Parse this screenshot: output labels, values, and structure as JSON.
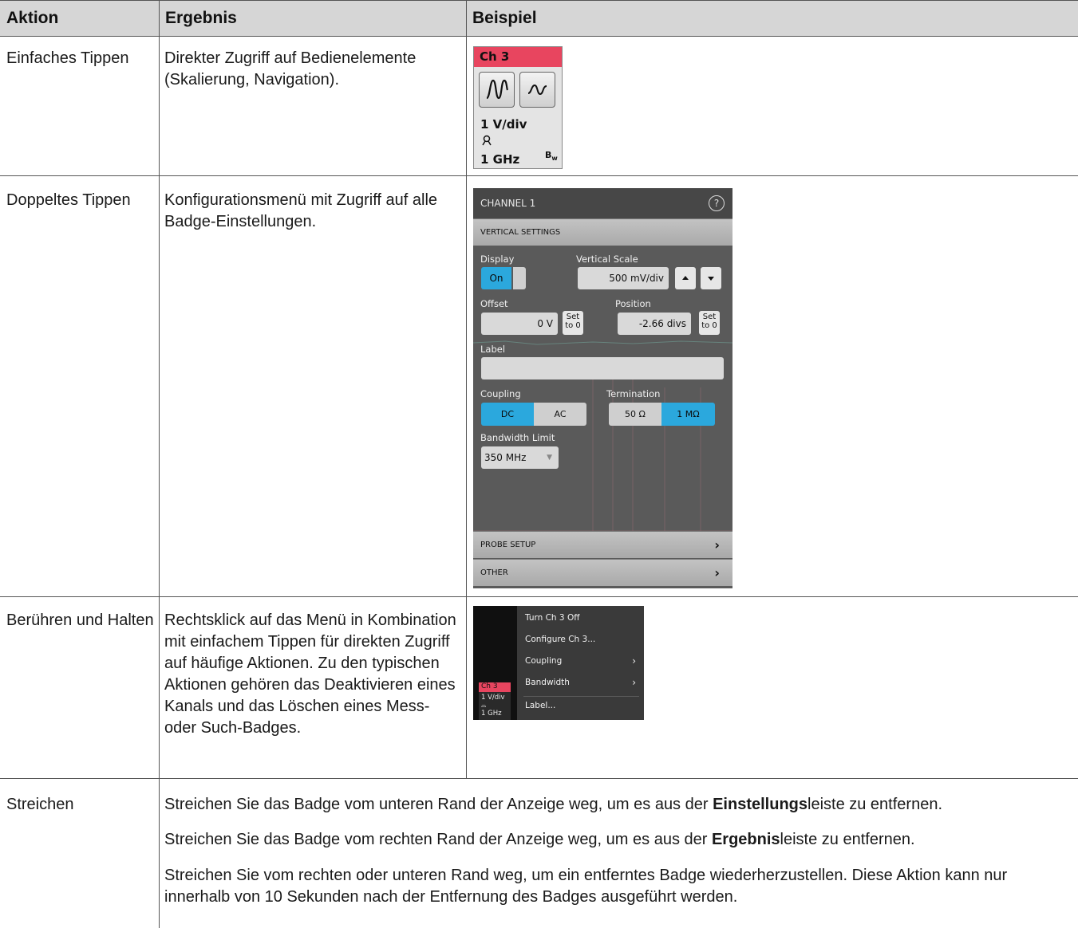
{
  "header": {
    "col_action": "Aktion",
    "col_result": "Ergebnis",
    "col_example": "Beispiel"
  },
  "rows": [
    {
      "action": "Einfaches Tippen",
      "result": "Direkter Zugriff auf Bedienelemente (Skalierung, Navigation)."
    },
    {
      "action": "Doppeltes Tippen",
      "result": "Konfigurationsmenü mit Zugriff auf alle Badge-Einstellungen."
    },
    {
      "action": "Berühren und Halten",
      "result": "Rechtsklick auf das Menü in Kombination mit einfachem Tippen für direkten Zugriff auf häufige Aktionen. Zu den typischen Aktionen gehören das Deaktivieren eines Kanals und das Löschen eines Mess- oder Such-Badges."
    },
    {
      "action": "Streichen",
      "p1_pre": "Streichen Sie das Badge vom unteren Rand der Anzeige weg, um es aus der ",
      "p1_bold": "Einstellungs",
      "p1_post": "leiste zu entfernen.",
      "p2_pre": "Streichen Sie das Badge vom rechten Rand der Anzeige weg, um es aus der ",
      "p2_bold": "Ergebnis",
      "p2_post": "leiste zu entfernen.",
      "p3": "Streichen Sie vom rechten oder unteren Rand weg, um ein entferntes Badge wiederherzustellen. Diese Aktion kann nur innerhalb von 10 Sekunden nach der Entfernung des Badges ausgeführt werden."
    }
  ],
  "example_badge": {
    "title": "Ch 3",
    "scale": "1 V/div",
    "bandwidth": "1 GHz",
    "bw_mark": "B",
    "bw_sub": "w",
    "btn1_icon": "large-wave-icon",
    "btn2_icon": "small-wave-icon",
    "probe_icon": "probe-icon",
    "accent": "#e8455f"
  },
  "example_menu": {
    "title": "CHANNEL 1",
    "help_glyph": "?",
    "vertical_settings": "VERTICAL SETTINGS",
    "display_label": "Display",
    "display_value": "On",
    "vscale_label": "Vertical Scale",
    "vscale_value": "500 mV/div",
    "offset_label": "Offset",
    "offset_value": "0 V",
    "position_label": "Position",
    "position_value": "-2.66 divs",
    "set_line1": "Set",
    "set_line2": "to 0",
    "label_label": "Label",
    "label_value": "",
    "coupling_label": "Coupling",
    "coupling_options": [
      "DC",
      "AC"
    ],
    "coupling_selected": "DC",
    "termination_label": "Termination",
    "termination_options": [
      "50 Ω",
      "1 MΩ"
    ],
    "termination_selected": "1 MΩ",
    "bwlimit_label": "Bandwidth Limit",
    "bwlimit_value": "350 MHz",
    "probe_setup": "PROBE SETUP",
    "other": "OTHER",
    "accent": "#2ba8dd"
  },
  "example_context": {
    "items": [
      "Turn Ch 3 Off",
      "Configure Ch 3...",
      "Coupling",
      "Bandwidth",
      "Label..."
    ],
    "mini_title": "Ch 3",
    "mini_scale": "1 V/div",
    "mini_bw": "1 GHz"
  }
}
